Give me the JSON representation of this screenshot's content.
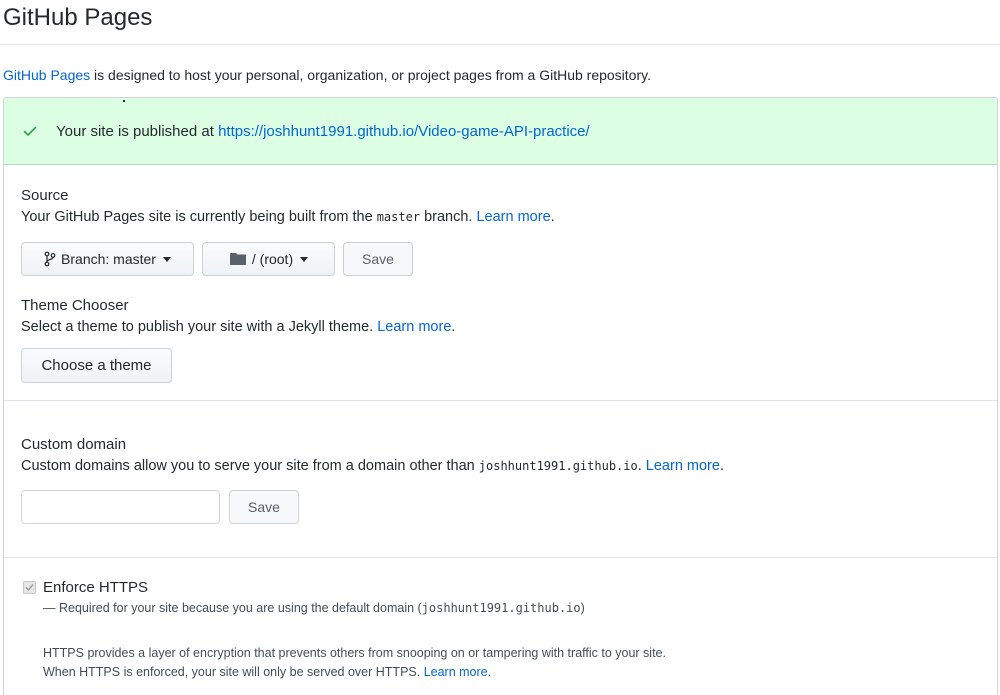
{
  "page": {
    "title": "GitHub Pages",
    "intro": {
      "link": "GitHub Pages",
      "text": " is designed to host your personal, organization, or project pages from a GitHub repository."
    }
  },
  "flash": {
    "icon": "check-icon",
    "prefix": "Your site is published at ",
    "url": "https://joshhunt1991.github.io/Video-game-API-practice/",
    "color": "#dcffe4"
  },
  "source": {
    "title": "Source",
    "desc_prefix": "Your GitHub Pages site is currently being built from the ",
    "branch_code": "master",
    "desc_suffix": " branch. ",
    "learn_more": "Learn more",
    "period": ".",
    "branch_button": "Branch: master",
    "folder_button": "/ (root)",
    "save_button": "Save"
  },
  "theme": {
    "title": "Theme Chooser",
    "desc": "Select a theme to publish your site with a Jekyll theme. ",
    "learn_more": "Learn more",
    "period": ".",
    "button": "Choose a theme"
  },
  "custom_domain": {
    "title": "Custom domain",
    "desc_prefix": "Custom domains allow you to serve your site from a domain other than ",
    "domain_code": "joshhunt1991.github.io",
    "desc_suffix": ". ",
    "learn_more": "Learn more",
    "period": ".",
    "input_value": "",
    "save_button": "Save"
  },
  "https": {
    "label": "Enforce HTTPS",
    "checked": true,
    "disabled": true,
    "note_prefix": "— Required for your site because you are using the default domain (",
    "note_code": "joshhunt1991.github.io",
    "note_suffix": ")",
    "info_line1": "HTTPS provides a layer of encryption that prevents others from snooping on or tampering with traffic to your site.",
    "info_line2": "When HTTPS is enforced, your site will only be served over HTTPS. ",
    "learn_more": "Learn more."
  },
  "colors": {
    "link": "#0366d6",
    "success": "#28a745",
    "text": "#24292e"
  }
}
